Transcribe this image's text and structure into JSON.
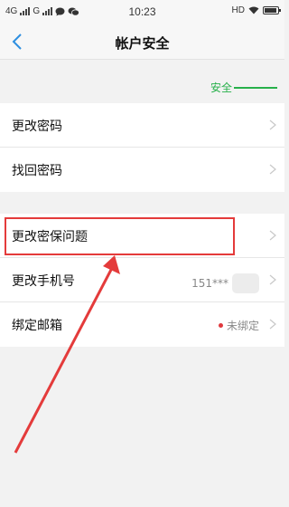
{
  "status_bar": {
    "carrier1": "4G",
    "carrier2": "G",
    "time": "10:23",
    "hd": "HD"
  },
  "header": {
    "title": "帐户安全"
  },
  "security": {
    "label": "安全",
    "color": "#27b04a"
  },
  "group1": [
    {
      "label": "更改密码"
    },
    {
      "label": "找回密码"
    }
  ],
  "group2": [
    {
      "label": "更改密保问题"
    },
    {
      "label": "更改手机号",
      "value": "151***"
    },
    {
      "label": "绑定邮箱",
      "value": "未绑定"
    }
  ],
  "colors": {
    "highlight": "#e43b3b",
    "unbound_dot": "#e0393e"
  },
  "icons": [
    "back-arrow-icon",
    "chevron-right-icon",
    "signal-icon",
    "wifi-icon",
    "battery-icon",
    "chat-icon",
    "wechat-icon"
  ]
}
